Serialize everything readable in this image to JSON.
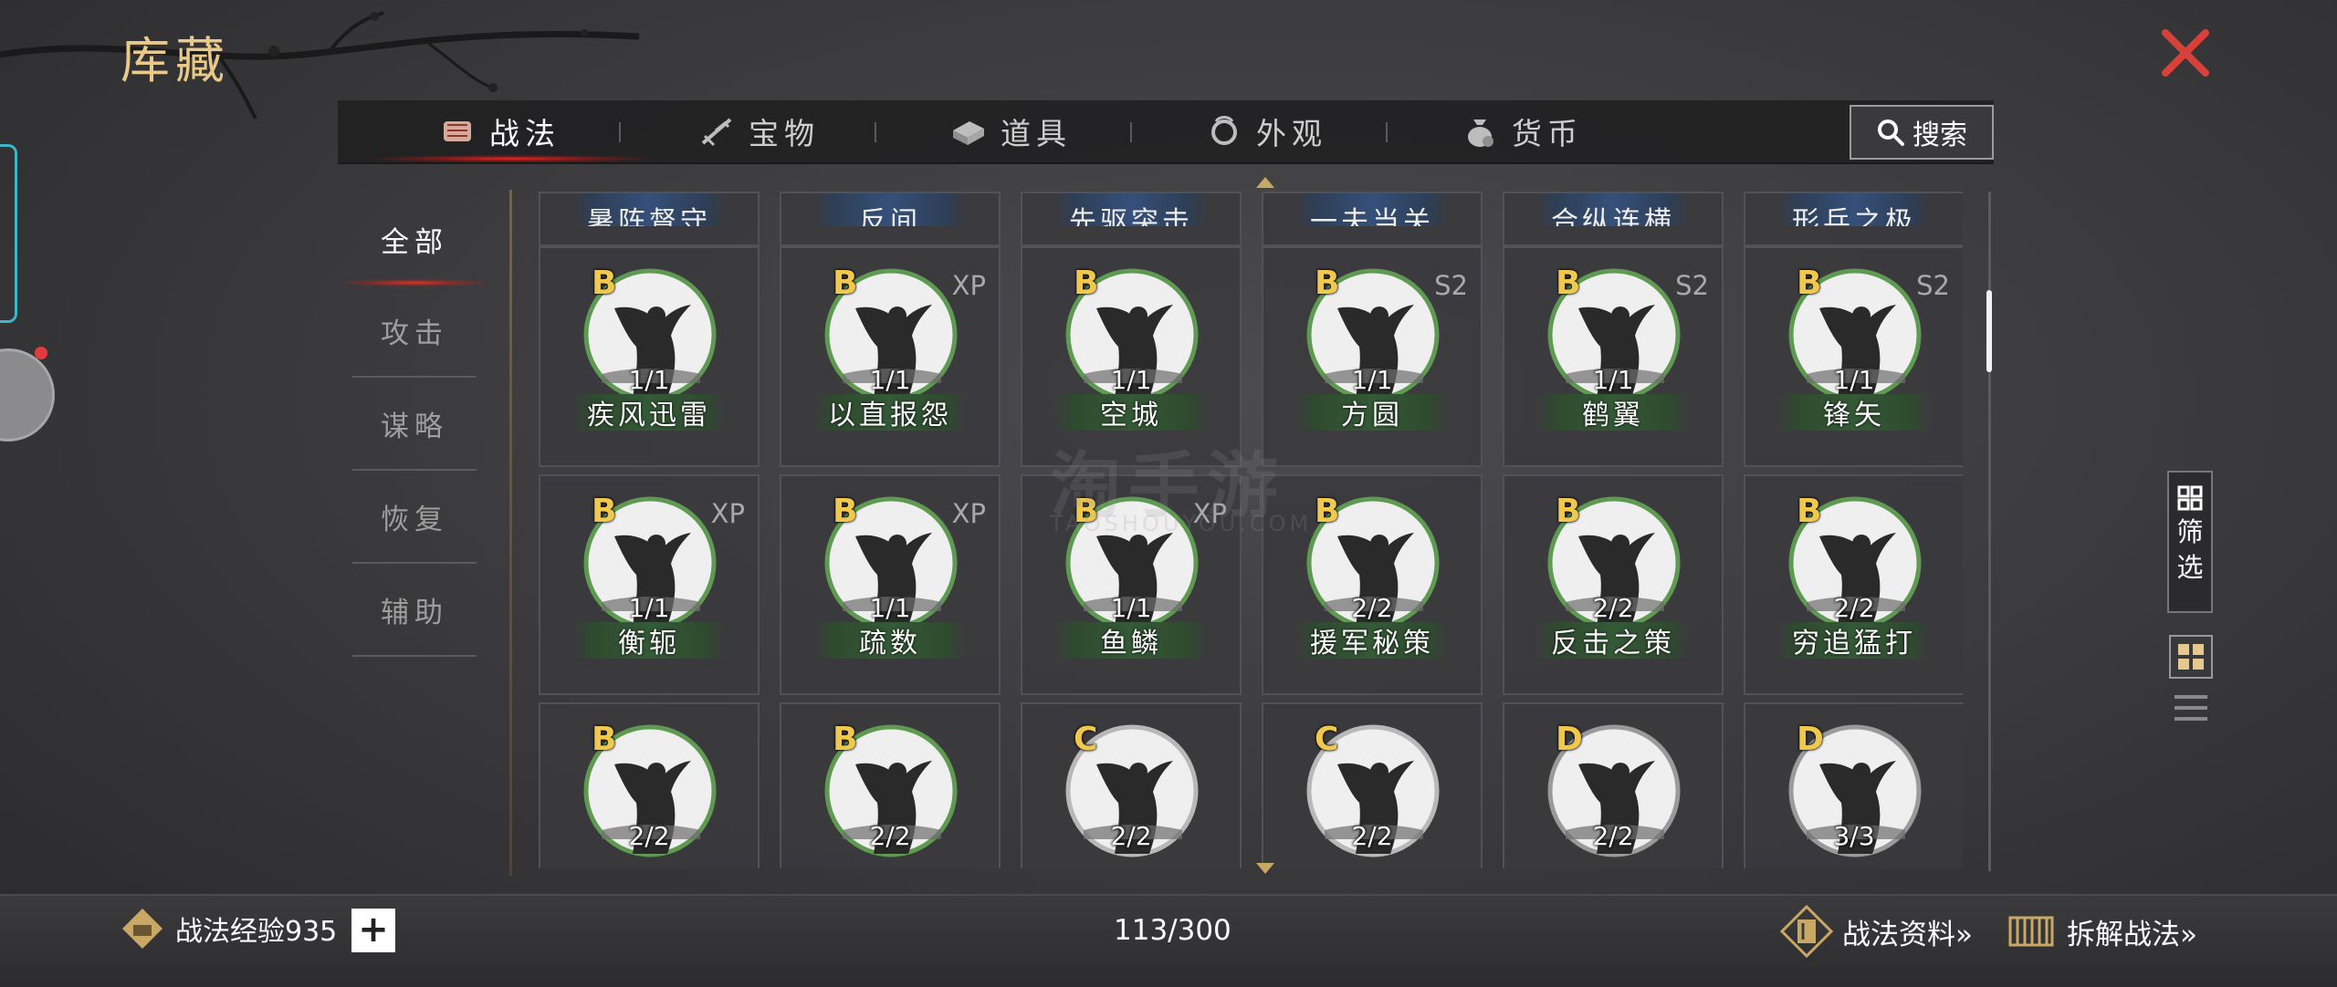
{
  "page_title": "库藏",
  "tabs": [
    {
      "label": "战法",
      "icon": "scroll-icon"
    },
    {
      "label": "宝物",
      "icon": "treasure-icon"
    },
    {
      "label": "道具",
      "icon": "item-icon"
    },
    {
      "label": "外观",
      "icon": "appearance-icon"
    },
    {
      "label": "货币",
      "icon": "money-bag-icon"
    }
  ],
  "search": {
    "label": "搜索"
  },
  "categories": [
    "全部",
    "攻击",
    "谋略",
    "恢复",
    "辅助"
  ],
  "active_category": "全部",
  "partial_top_row": [
    "暑阵督守",
    "反间",
    "先驱突击",
    "一夫当关",
    "合纵连横",
    "形兵之极"
  ],
  "cards_row1": [
    {
      "grade": "B",
      "tag": "",
      "level": "1/1",
      "name": "疾风迅雷"
    },
    {
      "grade": "B",
      "tag": "XP",
      "level": "1/1",
      "name": "以直报怨"
    },
    {
      "grade": "B",
      "tag": "",
      "level": "1/1",
      "name": "空城"
    },
    {
      "grade": "B",
      "tag": "S2",
      "level": "1/1",
      "name": "方圆"
    },
    {
      "grade": "B",
      "tag": "S2",
      "level": "1/1",
      "name": "鹤翼"
    },
    {
      "grade": "B",
      "tag": "S2",
      "level": "1/1",
      "name": "锋矢"
    }
  ],
  "cards_row2": [
    {
      "grade": "B",
      "tag": "XP",
      "level": "1/1",
      "name": "衡轭"
    },
    {
      "grade": "B",
      "tag": "XP",
      "level": "1/1",
      "name": "疏数"
    },
    {
      "grade": "B",
      "tag": "XP",
      "level": "1/1",
      "name": "鱼鳞"
    },
    {
      "grade": "B",
      "tag": "",
      "level": "2/2",
      "name": "援军秘策"
    },
    {
      "grade": "B",
      "tag": "",
      "level": "2/2",
      "name": "反击之策"
    },
    {
      "grade": "B",
      "tag": "",
      "level": "2/2",
      "name": "穷追猛打"
    }
  ],
  "cards_row3": [
    {
      "grade": "B",
      "tag": "",
      "level": "2/2"
    },
    {
      "grade": "B",
      "tag": "",
      "level": "2/2"
    },
    {
      "grade": "C",
      "tag": "",
      "level": "2/2"
    },
    {
      "grade": "C",
      "tag": "",
      "level": "2/2"
    },
    {
      "grade": "D",
      "tag": "",
      "level": "2/2"
    },
    {
      "grade": "D",
      "tag": "",
      "level": "3/3"
    }
  ],
  "filter": {
    "label1": "筛",
    "label2": "选"
  },
  "bottom": {
    "exp_label": "战法经验935",
    "plus": "+",
    "count": "113/300",
    "info_link": "战法资料»",
    "dismantle_link": "拆解战法»"
  },
  "watermark": {
    "line1": "淘手游",
    "line2": "TAOSHOUYOU.COM"
  },
  "colors": {
    "accent_gold": "#e8c98a",
    "grade_gold": "#f0c94c",
    "close_red": "#d9403a",
    "plate_green": "#345a36"
  }
}
